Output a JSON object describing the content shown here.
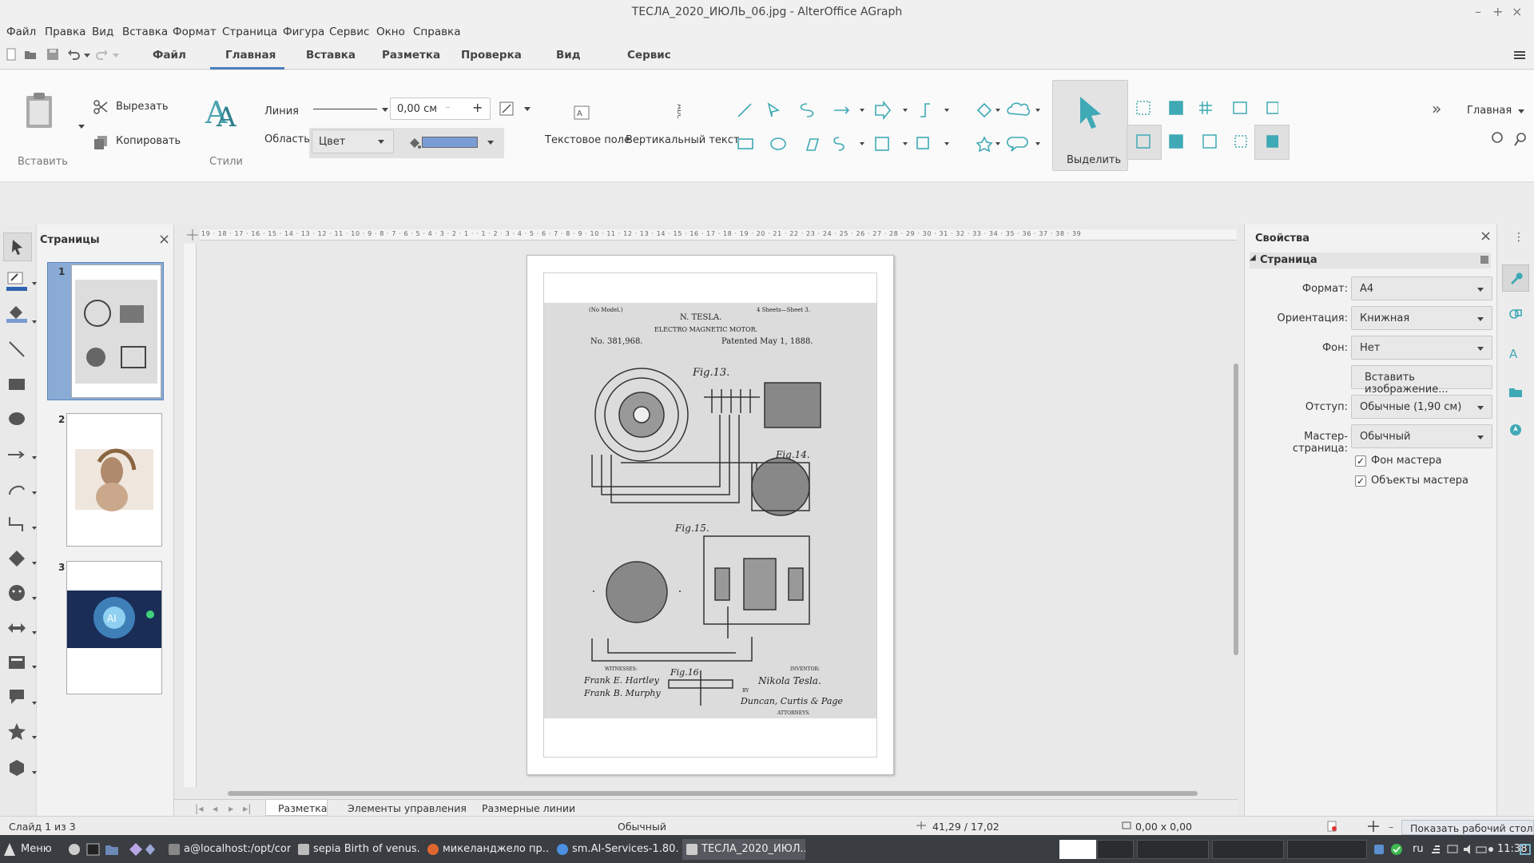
{
  "window": {
    "title": "ТЕСЛА_2020_ИЮЛЬ_06.jpg - AlterOffice AGraph",
    "minimize": "–",
    "maximize": "+",
    "close": "×"
  },
  "menu": [
    "Файл",
    "Правка",
    "Вид",
    "Вставка",
    "Формат",
    "Страница",
    "Фигура",
    "Сервис",
    "Окно",
    "Справка"
  ],
  "tabs": {
    "items": [
      "Файл",
      "Главная",
      "Вставка",
      "Разметка",
      "Проверка",
      "Вид",
      "Сервис"
    ],
    "active": "Главная"
  },
  "ribbon": {
    "paste_label": "Вставить",
    "cut_label": "Вырезать",
    "copy_label": "Копировать",
    "styles_label": "Стили",
    "line_label": "Линия",
    "line_width": "0,00 см",
    "area_label": "Область",
    "area_value": "Цвет",
    "fill_color": "#7a9cd4",
    "textbox_label": "Текстовое поле",
    "vertical_text_label": "Вертикальный текст",
    "select_label": "Выделить",
    "mode_label": "Главная",
    "accent_color": "#3fa9b5"
  },
  "pages_panel": {
    "title": "Страницы",
    "close": "×",
    "pages": [
      "1",
      "2",
      "3"
    ],
    "selected": "1"
  },
  "patent": {
    "no_model": "(No Model.)",
    "inventor": "N. TESLA.",
    "sheets": "4 Sheets—Sheet 3.",
    "title": "ELECTRO MAGNETIC MOTOR.",
    "number": "No. 381,968.",
    "patented": "Patented May 1, 1888.",
    "fig13": "Fig.13.",
    "fig14": "Fig.14.",
    "fig15": "Fig.15.",
    "fig16": "Fig.16",
    "witnesses": "WITNESSES:",
    "inventor_label": "INVENTOR:",
    "attorneys": "ATTORNEYS.",
    "sig_witness1": "Frank E. Hartley",
    "sig_witness2": "Frank B. Murphy",
    "sig_inventor": "Nikola Tesla.",
    "sig_by": "BY",
    "sig_attorneys": "Duncan, Curtis & Page"
  },
  "bottom_tabs": [
    "Разметка",
    "Элементы управления",
    "Размерные линии"
  ],
  "properties": {
    "title": "Свойства",
    "close": "×",
    "section": "Страница",
    "format_label": "Формат:",
    "format_value": "А4",
    "orientation_label": "Ориентация:",
    "orientation_value": "Книжная",
    "background_label": "Фон:",
    "background_value": "Нет",
    "insert_image_button": "Вставить изображение...",
    "margin_label": "Отступ:",
    "margin_value": "Обычные (1,90 см)",
    "master_label": "Мастер-страница:",
    "master_value": "Обычный",
    "master_bg_label": "Фон мастера",
    "master_bg_checked": true,
    "master_objects_label": "Объекты мастера",
    "master_objects_checked": true
  },
  "statusbar": {
    "slide": "Слайд 1 из 3",
    "layout": "Обычный",
    "position": "41,29 / 17,02",
    "size": "0,00 x 0,00",
    "zoom_minus": "–",
    "show_desktop": "Показать рабочий стол"
  },
  "taskbar": {
    "menu": "Меню",
    "tasks": [
      {
        "label": "a@localhost:/opt/core",
        "color": "#888"
      },
      {
        "label": "sepia Birth of venus...",
        "color": "#bbb"
      },
      {
        "label": "микеланджело пр...",
        "color": "#e0662f"
      },
      {
        "label": "sm.AI-Services-1.80...",
        "color": "#4a8fe0"
      },
      {
        "label": "ТЕСЛА_2020_ИЮЛ...",
        "color": "#ccc"
      }
    ],
    "lang": "ru",
    "time": "11:38"
  },
  "ruler_marks": "19 · 18 · 17 · 16 · 15 · 14 · 13 · 12 · 11 · 10 · 9 · 8 · 7 · 6 · 5 · 4 · 3 · 2 · 1 · · 1 · 2 · 3 · 4 · 5 · 6 · 7 · 8 · 9 · 10 · 11 · 12 · 13 · 14 · 15 · 16 · 17 · 18 · 19 · 20 · 21 · 22 · 23 · 24 · 25 · 26 · 27 · 28 · 29 · 30 · 31 · 32 · 33 · 34 · 35 · 36 · 37 · 38 · 39"
}
